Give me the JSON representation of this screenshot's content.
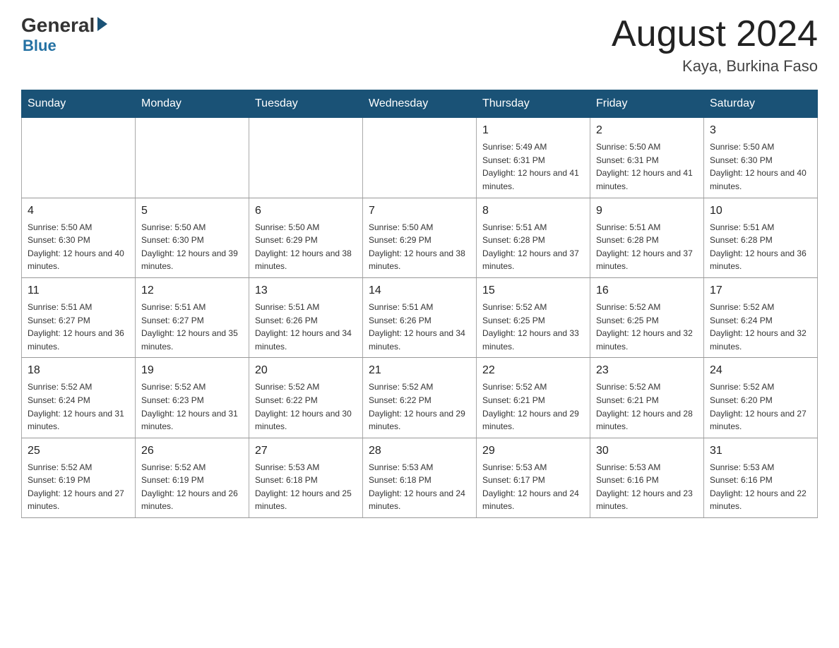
{
  "header": {
    "logo_general": "General",
    "logo_blue": "Blue",
    "month_title": "August 2024",
    "location": "Kaya, Burkina Faso"
  },
  "days_of_week": [
    "Sunday",
    "Monday",
    "Tuesday",
    "Wednesday",
    "Thursday",
    "Friday",
    "Saturday"
  ],
  "weeks": [
    [
      {
        "num": "",
        "info": ""
      },
      {
        "num": "",
        "info": ""
      },
      {
        "num": "",
        "info": ""
      },
      {
        "num": "",
        "info": ""
      },
      {
        "num": "1",
        "info": "Sunrise: 5:49 AM\nSunset: 6:31 PM\nDaylight: 12 hours and 41 minutes."
      },
      {
        "num": "2",
        "info": "Sunrise: 5:50 AM\nSunset: 6:31 PM\nDaylight: 12 hours and 41 minutes."
      },
      {
        "num": "3",
        "info": "Sunrise: 5:50 AM\nSunset: 6:30 PM\nDaylight: 12 hours and 40 minutes."
      }
    ],
    [
      {
        "num": "4",
        "info": "Sunrise: 5:50 AM\nSunset: 6:30 PM\nDaylight: 12 hours and 40 minutes."
      },
      {
        "num": "5",
        "info": "Sunrise: 5:50 AM\nSunset: 6:30 PM\nDaylight: 12 hours and 39 minutes."
      },
      {
        "num": "6",
        "info": "Sunrise: 5:50 AM\nSunset: 6:29 PM\nDaylight: 12 hours and 38 minutes."
      },
      {
        "num": "7",
        "info": "Sunrise: 5:50 AM\nSunset: 6:29 PM\nDaylight: 12 hours and 38 minutes."
      },
      {
        "num": "8",
        "info": "Sunrise: 5:51 AM\nSunset: 6:28 PM\nDaylight: 12 hours and 37 minutes."
      },
      {
        "num": "9",
        "info": "Sunrise: 5:51 AM\nSunset: 6:28 PM\nDaylight: 12 hours and 37 minutes."
      },
      {
        "num": "10",
        "info": "Sunrise: 5:51 AM\nSunset: 6:28 PM\nDaylight: 12 hours and 36 minutes."
      }
    ],
    [
      {
        "num": "11",
        "info": "Sunrise: 5:51 AM\nSunset: 6:27 PM\nDaylight: 12 hours and 36 minutes."
      },
      {
        "num": "12",
        "info": "Sunrise: 5:51 AM\nSunset: 6:27 PM\nDaylight: 12 hours and 35 minutes."
      },
      {
        "num": "13",
        "info": "Sunrise: 5:51 AM\nSunset: 6:26 PM\nDaylight: 12 hours and 34 minutes."
      },
      {
        "num": "14",
        "info": "Sunrise: 5:51 AM\nSunset: 6:26 PM\nDaylight: 12 hours and 34 minutes."
      },
      {
        "num": "15",
        "info": "Sunrise: 5:52 AM\nSunset: 6:25 PM\nDaylight: 12 hours and 33 minutes."
      },
      {
        "num": "16",
        "info": "Sunrise: 5:52 AM\nSunset: 6:25 PM\nDaylight: 12 hours and 32 minutes."
      },
      {
        "num": "17",
        "info": "Sunrise: 5:52 AM\nSunset: 6:24 PM\nDaylight: 12 hours and 32 minutes."
      }
    ],
    [
      {
        "num": "18",
        "info": "Sunrise: 5:52 AM\nSunset: 6:24 PM\nDaylight: 12 hours and 31 minutes."
      },
      {
        "num": "19",
        "info": "Sunrise: 5:52 AM\nSunset: 6:23 PM\nDaylight: 12 hours and 31 minutes."
      },
      {
        "num": "20",
        "info": "Sunrise: 5:52 AM\nSunset: 6:22 PM\nDaylight: 12 hours and 30 minutes."
      },
      {
        "num": "21",
        "info": "Sunrise: 5:52 AM\nSunset: 6:22 PM\nDaylight: 12 hours and 29 minutes."
      },
      {
        "num": "22",
        "info": "Sunrise: 5:52 AM\nSunset: 6:21 PM\nDaylight: 12 hours and 29 minutes."
      },
      {
        "num": "23",
        "info": "Sunrise: 5:52 AM\nSunset: 6:21 PM\nDaylight: 12 hours and 28 minutes."
      },
      {
        "num": "24",
        "info": "Sunrise: 5:52 AM\nSunset: 6:20 PM\nDaylight: 12 hours and 27 minutes."
      }
    ],
    [
      {
        "num": "25",
        "info": "Sunrise: 5:52 AM\nSunset: 6:19 PM\nDaylight: 12 hours and 27 minutes."
      },
      {
        "num": "26",
        "info": "Sunrise: 5:52 AM\nSunset: 6:19 PM\nDaylight: 12 hours and 26 minutes."
      },
      {
        "num": "27",
        "info": "Sunrise: 5:53 AM\nSunset: 6:18 PM\nDaylight: 12 hours and 25 minutes."
      },
      {
        "num": "28",
        "info": "Sunrise: 5:53 AM\nSunset: 6:18 PM\nDaylight: 12 hours and 24 minutes."
      },
      {
        "num": "29",
        "info": "Sunrise: 5:53 AM\nSunset: 6:17 PM\nDaylight: 12 hours and 24 minutes."
      },
      {
        "num": "30",
        "info": "Sunrise: 5:53 AM\nSunset: 6:16 PM\nDaylight: 12 hours and 23 minutes."
      },
      {
        "num": "31",
        "info": "Sunrise: 5:53 AM\nSunset: 6:16 PM\nDaylight: 12 hours and 22 minutes."
      }
    ]
  ]
}
